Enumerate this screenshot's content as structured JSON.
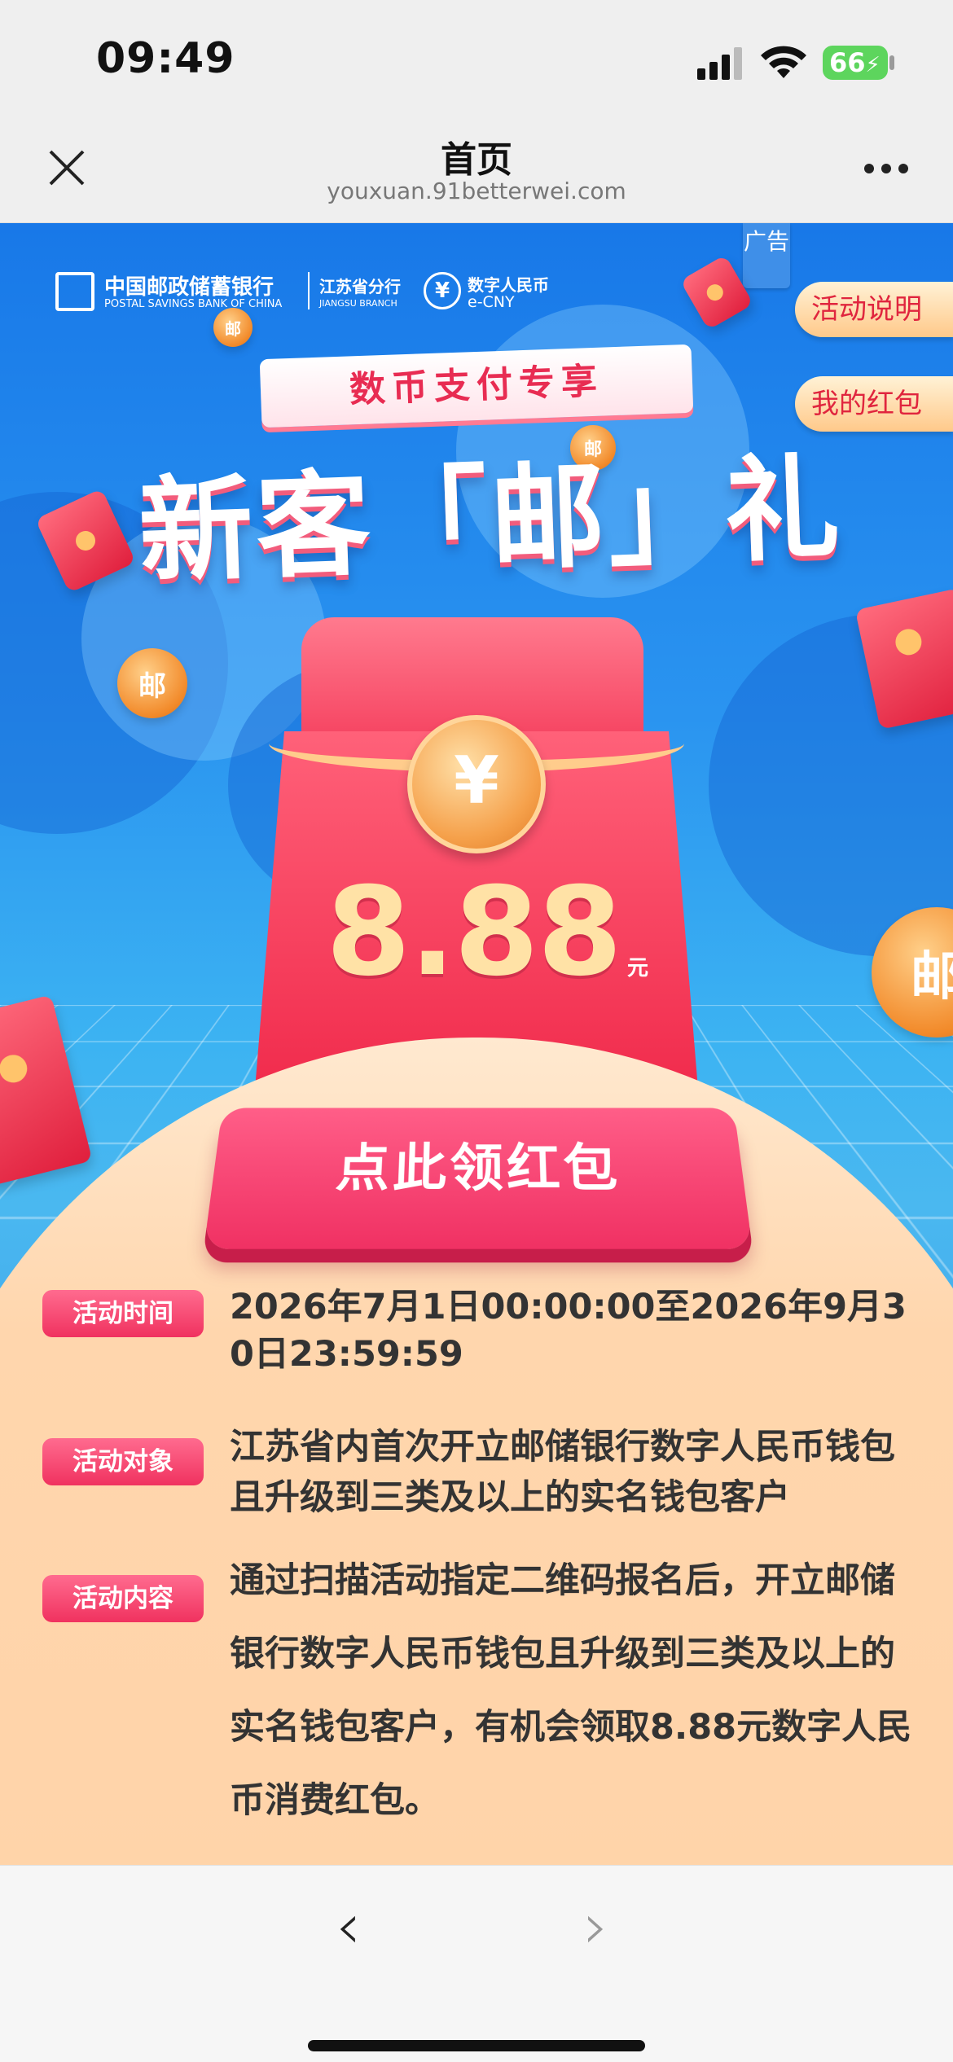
{
  "status_bar": {
    "time": "09:49",
    "battery": "66"
  },
  "nav": {
    "title": "首页",
    "url": "youxuan.91betterwei.com"
  },
  "header": {
    "bank_cn": "中国邮政储蓄银行",
    "bank_en": "POSTAL SAVINGS BANK OF CHINA",
    "branch_cn": "江苏省分行",
    "branch_en": "JIANGSU BRANCH",
    "ecny_cn": "数字人民币",
    "ecny_en": "e-CNY",
    "ad_label": "广告"
  },
  "side_buttons": {
    "rules": "活动说明",
    "my_packets": "我的红包"
  },
  "banner": {
    "subtitle": "数币支付专享",
    "headline": "新客「邮」礼"
  },
  "envelope": {
    "amount": "8.88",
    "unit": "元",
    "symbol": "¥"
  },
  "claim_button": "点此领红包",
  "info": [
    {
      "tag": "活动时间",
      "text": "2026年7月1日00:00:00至2026年9月30日23:59:59"
    },
    {
      "tag": "活动对象",
      "text": "江苏省内首次开立邮储银行数字人民币钱包且升级到三类及以上的实名钱包客户"
    },
    {
      "tag": "活动内容",
      "text": "通过扫描活动指定二维码报名后，开立邮储银行数字人民币钱包且升级到三类及以上的实名钱包客户，有机会领取8.88元数字人民币消费红包。"
    }
  ],
  "toolbar": {
    "back_glyph": "‹",
    "forward_glyph": "›"
  },
  "colors": {
    "accent": "#f03163",
    "background_blue": "#2a94f0",
    "cream": "#ffd6ad"
  }
}
